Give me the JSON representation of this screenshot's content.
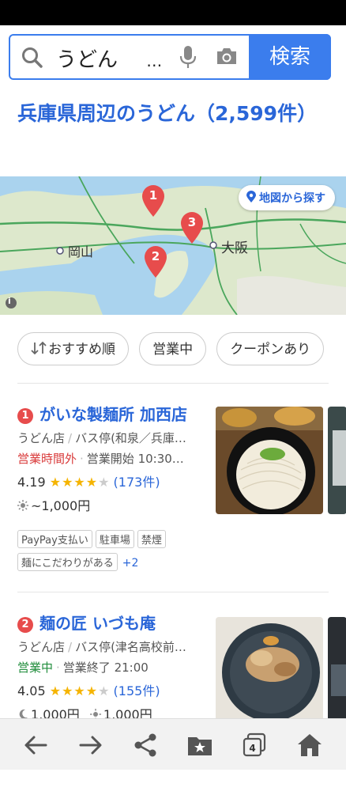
{
  "search": {
    "query": "うどん",
    "ellipsis": "…",
    "button_label": "検索"
  },
  "page_title": "兵庫県周辺のうどん（2,599件）",
  "map": {
    "find_button_label": "地図から探す",
    "labels": {
      "okayama": "岡山",
      "osaka": "大阪"
    },
    "pins": [
      "1",
      "2",
      "3"
    ]
  },
  "filters": [
    "おすすめ順",
    "営業中",
    "クーポンあり"
  ],
  "results": [
    {
      "number": "1",
      "name": "がいな製麺所 加西店",
      "category": "うどん店",
      "access": "バス停(和泉／兵庫…",
      "status": "営業時間外",
      "hours": "営業開始 10:30…",
      "rating": "4.19",
      "stars_on": "★★★★",
      "stars_off": "★",
      "review_count": "(173件)",
      "price_lunch": "~1,000円",
      "tags": [
        "PayPay支払い",
        "駐車場",
        "禁煙",
        "麺にこだわりがある"
      ],
      "more_tags": "+2"
    },
    {
      "number": "2",
      "name": "麺の匠 いづも庵",
      "category": "うどん店",
      "access": "バス停(津名高校前…",
      "status": "営業中",
      "hours": "営業終了 21:00",
      "rating": "4.05",
      "stars_on": "★★★★",
      "stars_off": "★",
      "review_count": "(155件)",
      "price_dinner": "1,000円",
      "price_lunch": "1,000円"
    }
  ],
  "colors": {
    "accent": "#3b7ded",
    "link": "#2a66d8",
    "pin": "#e74c4c",
    "star": "#f5b400"
  }
}
